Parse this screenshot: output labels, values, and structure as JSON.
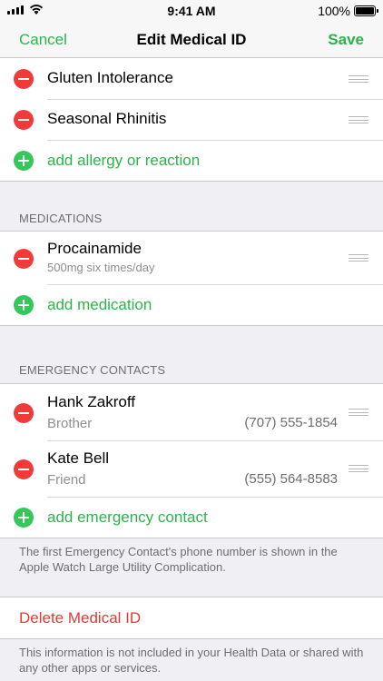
{
  "status_bar": {
    "time": "9:41 AM",
    "battery": "100%"
  },
  "nav": {
    "cancel": "Cancel",
    "title": "Edit Medical ID",
    "save": "Save"
  },
  "allergies": {
    "items": [
      {
        "label": "Gluten Intolerance"
      },
      {
        "label": "Seasonal Rhinitis"
      }
    ],
    "add_label": "add allergy or reaction"
  },
  "medications": {
    "header": "MEDICATIONS",
    "items": [
      {
        "name": "Procainamide",
        "dose": "500mg six times/day"
      }
    ],
    "add_label": "add medication"
  },
  "emergency_contacts": {
    "header": "EMERGENCY CONTACTS",
    "items": [
      {
        "name": "Hank Zakroff",
        "relation": "Brother",
        "phone": "(707) 555-1854"
      },
      {
        "name": "Kate Bell",
        "relation": "Friend",
        "phone": "(555) 564-8583"
      }
    ],
    "add_label": "add emergency contact",
    "footnote": "The first Emergency Contact's phone number is shown in the Apple Watch Large Utility Complication."
  },
  "delete": {
    "label": "Delete Medical ID"
  },
  "bottom_note": "This information is not included in your Health Data or shared with any other apps or services.",
  "colors": {
    "accent": "#2cb34a",
    "destructive": "#e53935",
    "remove": "#f13a3a",
    "add": "#34c759"
  }
}
